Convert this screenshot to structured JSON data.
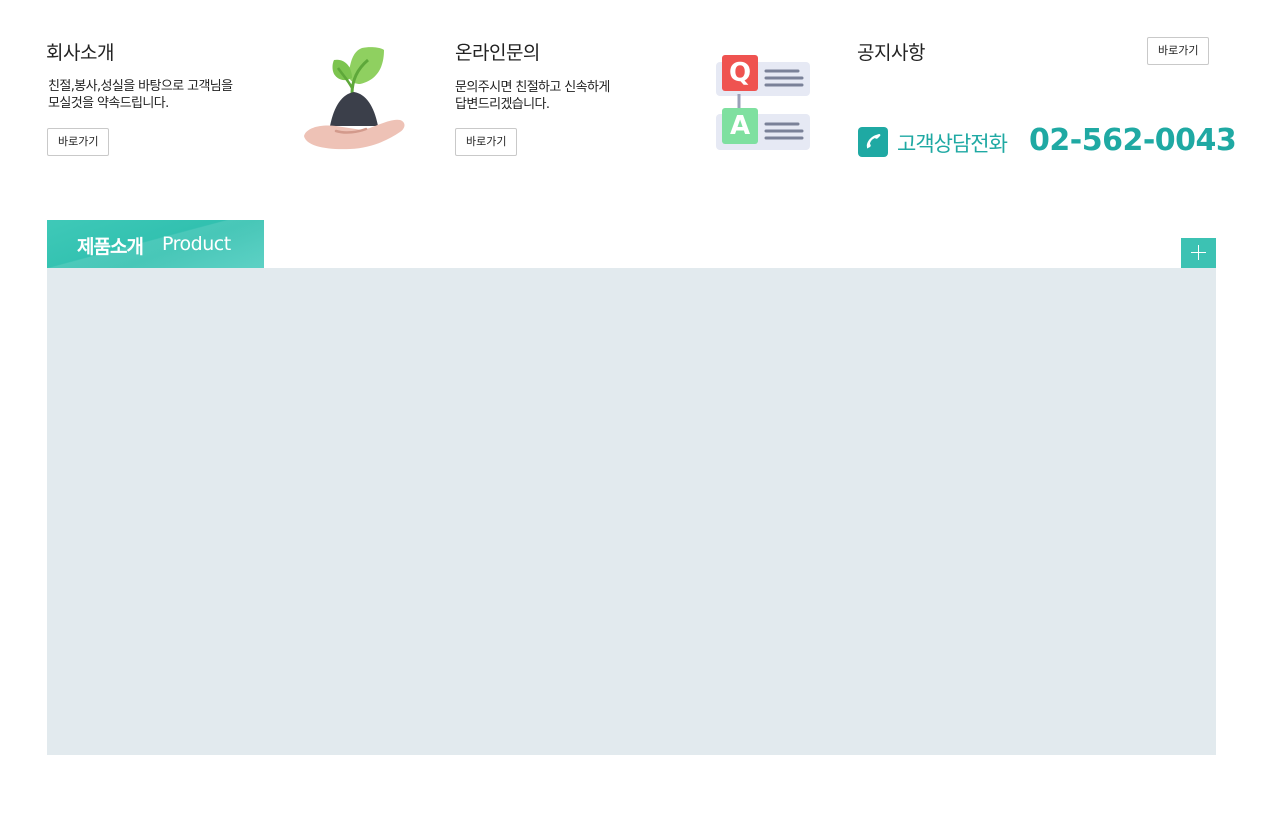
{
  "company": {
    "title": "회사소개",
    "desc_line1": "친절,봉사,성실을 바탕으로 고객님을",
    "desc_line2": "모실것을 약속드립니다.",
    "button_label": "바로가기",
    "illustration_icon": "plant-in-hand-icon"
  },
  "inquiry": {
    "title": "온라인문의",
    "desc_line1": "문의주시면 친절하고 신속하게",
    "desc_line2": "답변드리겠습니다.",
    "button_label": "바로가기",
    "illustration_icon": "qa-icon",
    "q_letter": "Q",
    "a_letter": "A"
  },
  "notice": {
    "title": "공지사항",
    "button_label": "바로가기"
  },
  "contact": {
    "icon": "phone-icon",
    "label": "고객상담전화",
    "number": "02-562-0043"
  },
  "product": {
    "title_ko": "제품소개",
    "title_en": "Product",
    "more_icon": "plus-icon"
  },
  "colors": {
    "accent": "#1fa9a3",
    "tab": "#2fbfae",
    "panel_bg": "#e2eaee"
  }
}
